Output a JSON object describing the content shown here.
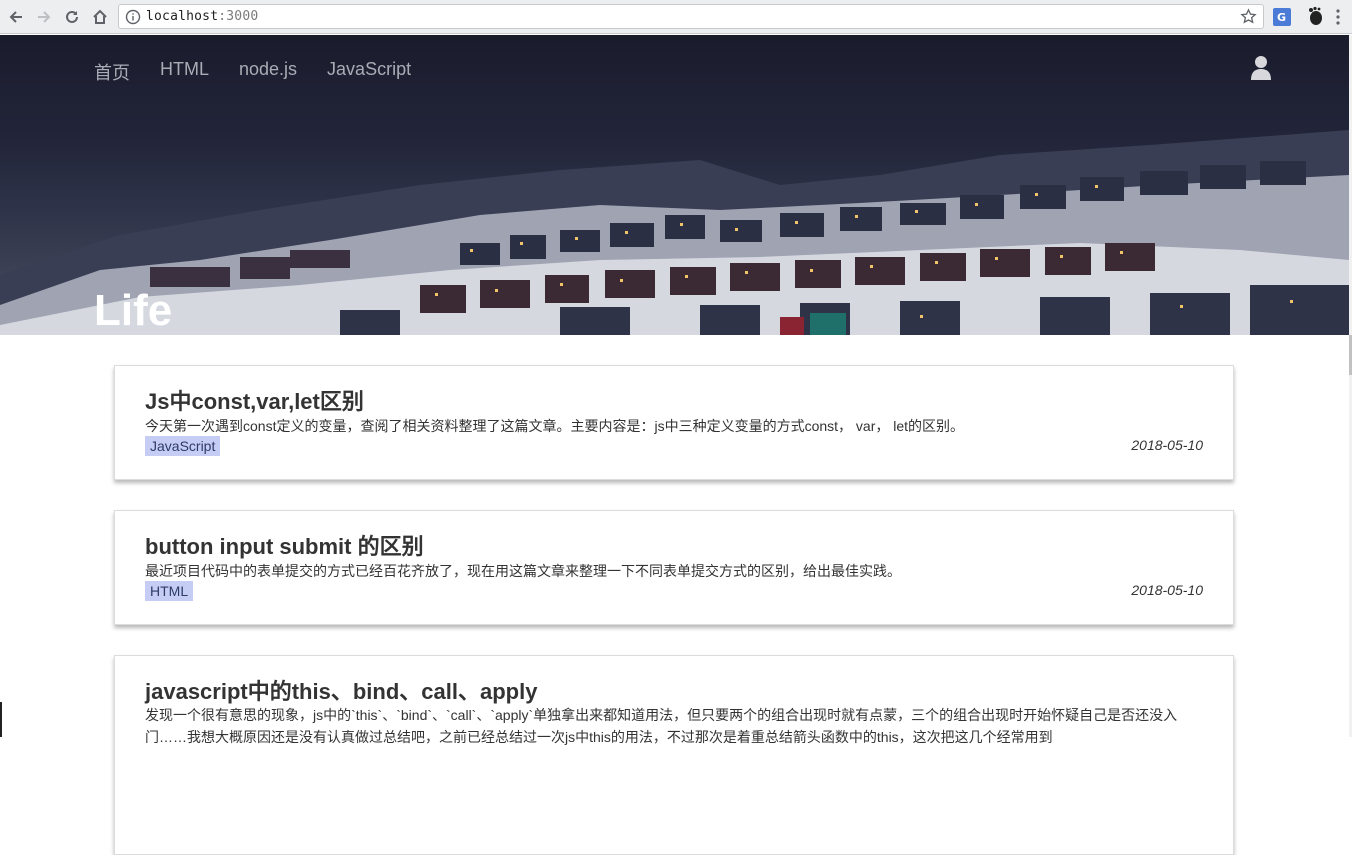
{
  "browser": {
    "url_host": "localhost",
    "url_port": ":3000"
  },
  "nav": {
    "items": [
      "首页",
      "HTML",
      "node.js",
      "JavaScript"
    ]
  },
  "hero": {
    "title": "Life"
  },
  "posts": [
    {
      "title": "Js中const,var,let区别",
      "excerpt": "今天第一次遇到const定义的变量，查阅了相关资料整理了这篇文章。主要内容是：js中三种定义变量的方式const， var， let的区别。",
      "tag": "JavaScript",
      "date": "2018-05-10"
    },
    {
      "title": "button input submit 的区别",
      "excerpt": "最近项目代码中的表单提交的方式已经百花齐放了，现在用这篇文章来整理一下不同表单提交方式的区别，给出最佳实践。",
      "tag": "HTML",
      "date": "2018-05-10"
    },
    {
      "title": "javascript中的this、bind、call、apply",
      "excerpt": "发现一个很有意思的现象，js中的`this`、`bind`、`call`、`apply`单独拿出来都知道用法，但只要两个的组合出现时就有点蒙，三个的组合出现时开始怀疑自己是否还没入门……我想大概原因还是没有认真做过总结吧，之前已经总结过一次js中this的用法，不过那次是着重总结箭头函数中的this，这次把这几个经常用到"
    }
  ],
  "colors": {
    "tag_bg": "#c5cdf5",
    "nav_text": "#a9abb5"
  }
}
